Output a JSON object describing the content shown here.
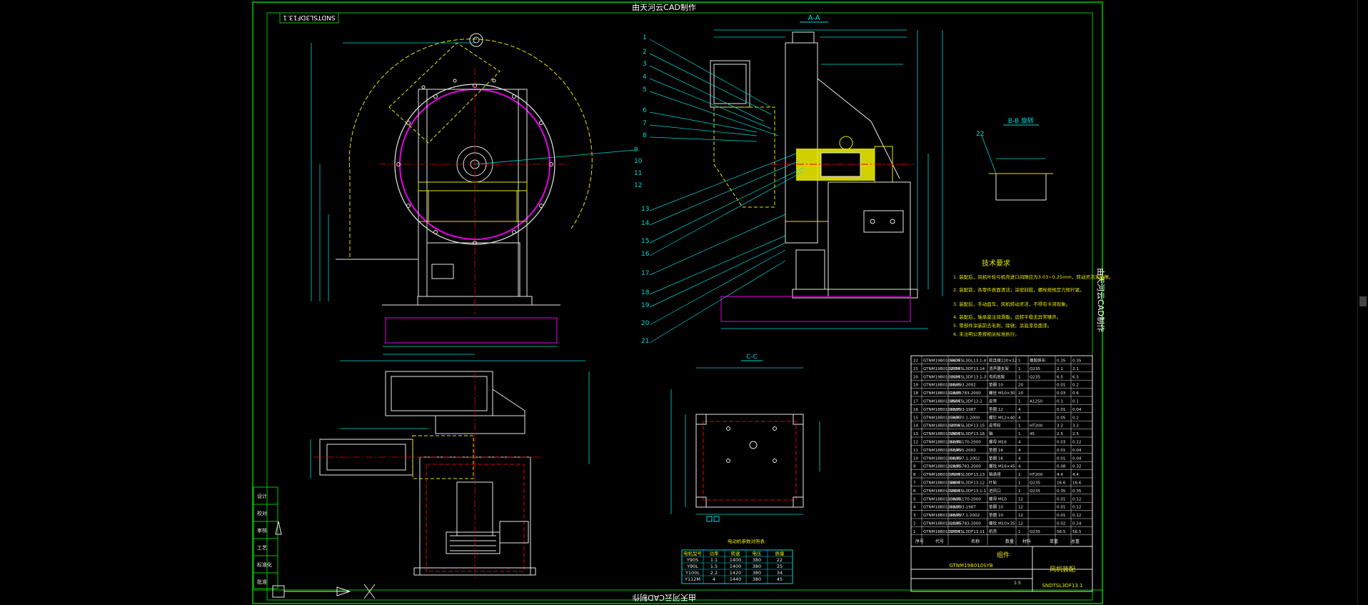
{
  "watermark_text": "由天河云CAD制作",
  "drawing_no": "SNDTSL3DF13.1",
  "title_block": {
    "name_cell": "组件",
    "product_name": "风机装配",
    "drawing_no": "SNDTSL3DF13.1",
    "sub_code": "GTNM19B010SYB"
  },
  "views": {
    "aa": "A-A",
    "bb": "B-B 旋转",
    "cc": "C-C"
  },
  "tech_requirements": {
    "title": "技术要求",
    "lines": [
      "1. 装配后，风机叶轮与机壳进口间隙应为3.03~0.25mm，转动灵活无碰擦。",
      "2. 装配前，各零件表面清洁；涂密封胶，螺栓按规定力矩拧紧。",
      "3. 装配后，手动盘车，风机转动灵活，不得有卡滞现象。",
      "4. 装配后，轴承座注润滑脂，运转平稳无异常噪声。",
      "5. 零部件涂装前去毛刺，除锈，涂底漆及面漆。",
      "6. 未注明公差按相关标准执行。"
    ]
  },
  "callouts": [
    "1",
    "2",
    "3",
    "4",
    "5",
    "6",
    "7",
    "8",
    "9",
    "10",
    "11",
    "12",
    "13",
    "14",
    "15",
    "16",
    "17",
    "18",
    "19",
    "20",
    "21",
    "22"
  ],
  "bom_rows": [
    [
      "22",
      "GTNM19B0105476",
      "SNDTSL3GL13.1-4",
      "软连接220×32",
      "1",
      "橡胶帆布",
      "0.35",
      "0.35"
    ],
    [
      "21",
      "GTNM19B0102786",
      "SNDTSL3DF13.14",
      "消声器支架",
      "1",
      "Q235",
      "2.1",
      "2.1"
    ],
    [
      "20",
      "GTNM19B0101186",
      "SNDTSL3DF13.1-3",
      "电机底座",
      "1",
      "Q235",
      "6.5",
      "6.5"
    ],
    [
      "19",
      "GTNM18B0104866",
      "GB/T93-2002",
      "垫圈 10",
      "20",
      "",
      "0.01",
      "0.2"
    ],
    [
      "18",
      "GTNM18B0101466",
      "GB/T5783-2000",
      "螺栓 M10×30",
      "20",
      "",
      "0.03",
      "0.6"
    ],
    [
      "17",
      "GTNM18B0104586",
      "SNDTSL3DF13.2",
      "皮带",
      "1",
      "A1250",
      "0.1",
      "0.1"
    ],
    [
      "16",
      "GTNM18B0104066",
      "GB/T93-1987",
      "垫圈 12",
      "4",
      "",
      "0.01",
      "0.04"
    ],
    [
      "15",
      "GTNM18B0103996",
      "GB/T70.1-2000",
      "螺钉 M12×40",
      "4",
      "",
      "0.05",
      "0.2"
    ],
    [
      "14",
      "GTNM18B0103796",
      "SNDTSL3DF13.15",
      "皮带轮",
      "1",
      "HT200",
      "3.2",
      "3.2"
    ],
    [
      "13",
      "GTNM18B0102996",
      "SNDTSL3DF13.16",
      "轴",
      "1",
      "45",
      "2.5",
      "2.5"
    ],
    [
      "12",
      "GTNM18B0106096",
      "GB/T6170-2000",
      "螺母 M16",
      "4",
      "",
      "0.03",
      "0.12"
    ],
    [
      "11",
      "GTNM18B0105596",
      "GB/T95-2002",
      "垫圈 16",
      "4",
      "",
      "0.01",
      "0.04"
    ],
    [
      "10",
      "GTNM18B0100696",
      "GB/T97.1-2002",
      "垫圈 16",
      "4",
      "",
      "0.01",
      "0.04"
    ],
    [
      "9",
      "GTNM18B0102996",
      "GB/T5783-2000",
      "螺栓 M16×45",
      "4",
      "",
      "0.08",
      "0.32"
    ],
    [
      "8",
      "GTNM18B0107196",
      "SNDTSL3DF13.13",
      "轴承座",
      "1",
      "HT200",
      "4.4",
      "4.4"
    ],
    [
      "7",
      "GTNM18B0106896",
      "SNDTSL3DF13.12",
      "叶轮",
      "1",
      "Q235",
      "16.6",
      "16.6"
    ],
    [
      "6",
      "GTNM18B0102396",
      "SNDTSL3DF13.1-1",
      "进风口",
      "1",
      "Q235",
      "0.35",
      "0.35"
    ],
    [
      "5",
      "GTNM18B0103966",
      "GB/T6170-2000",
      "螺母 M10",
      "12",
      "",
      "0.01",
      "0.12"
    ],
    [
      "4",
      "GTNM18B0104466",
      "GB/T93-1987",
      "垫圈 10",
      "12",
      "",
      "0.01",
      "0.12"
    ],
    [
      "3",
      "GTNM18B0104066",
      "GB/T97.1-2002",
      "垫圈 10",
      "12",
      "",
      "0.01",
      "0.12"
    ],
    [
      "2",
      "GTNM18B0102596",
      "GB/T5783-2000",
      "螺栓 M10×35",
      "12",
      "",
      "0.02",
      "0.24"
    ],
    [
      "1",
      "GTNM18B0101796",
      "SNDTSL3DF13.11",
      "机壳",
      "1",
      "Q235",
      "56.5",
      "56.5"
    ]
  ],
  "bom_header": [
    "序号",
    "代号",
    "名称",
    "数量",
    "材料",
    "单重",
    "总重"
  ],
  "small_table": {
    "title": "电动机参数对照表",
    "header": [
      "电机型号",
      "功率",
      "转速",
      "电压",
      "质量"
    ],
    "rows": [
      [
        "Y90S",
        "1.1",
        "1400",
        "380",
        "22"
      ],
      [
        "Y90L",
        "1.5",
        "1400",
        "380",
        "25"
      ],
      [
        "Y100L",
        "2.2",
        "1420",
        "380",
        "34"
      ],
      [
        "Y112M",
        "4",
        "1440",
        "380",
        "45"
      ]
    ]
  },
  "left_strip": [
    "设计",
    "校对",
    "审核",
    "工艺",
    "标准化",
    "批准"
  ],
  "scale_note": "1:5",
  "colors": {
    "frame": "#00c800",
    "cyan": "#00d8d8",
    "white": "#e8e8e8",
    "yellow": "#e8e800",
    "magenta": "#e800e8",
    "red": "#e80000"
  }
}
